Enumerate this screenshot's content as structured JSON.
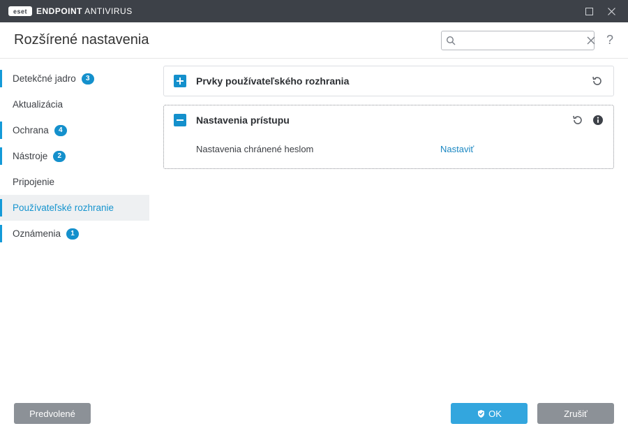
{
  "titlebar": {
    "brand_prefix": "ENDPOINT",
    "brand_suffix": " ANTIVIRUS"
  },
  "header": {
    "title": "Rozšírené nastavenia",
    "search_placeholder": ""
  },
  "sidebar": {
    "items": [
      {
        "label": "Detekčné jadro",
        "badge": "3",
        "indicator": true,
        "selected": false
      },
      {
        "label": "Aktualizácia",
        "badge": null,
        "indicator": false,
        "selected": false
      },
      {
        "label": "Ochrana",
        "badge": "4",
        "indicator": true,
        "selected": false
      },
      {
        "label": "Nástroje",
        "badge": "2",
        "indicator": true,
        "selected": false
      },
      {
        "label": "Pripojenie",
        "badge": null,
        "indicator": false,
        "selected": false
      },
      {
        "label": "Používateľské rozhranie",
        "badge": null,
        "indicator": true,
        "selected": true
      },
      {
        "label": "Oznámenia",
        "badge": "1",
        "indicator": true,
        "selected": false
      }
    ]
  },
  "panels": {
    "ui_elements": {
      "title": "Prvky používateľského rozhrania"
    },
    "access": {
      "title": "Nastavenia prístupu",
      "row0_label": "Nastavenia chránené heslom",
      "row0_action": "Nastaviť"
    }
  },
  "footer": {
    "default": "Predvolené",
    "ok": "OK",
    "cancel": "Zrušiť"
  }
}
